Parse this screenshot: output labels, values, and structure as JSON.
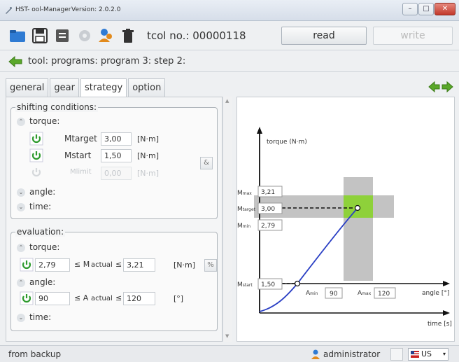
{
  "window": {
    "title": "HST- ool-Manager",
    "version": "Version: 2.0.2.0",
    "minimize": "–",
    "maximize": "□",
    "close": "✕"
  },
  "toolbar": {
    "tool_no": "tcol no.: 00000118",
    "read_label": "read",
    "write_label": "write",
    "icons": [
      "folder-icon",
      "save-icon",
      "list-icon",
      "gear-icon",
      "users-icon",
      "trash-icon"
    ]
  },
  "breadcrumb": "tool: programs: program 3: step 2:",
  "tabs": [
    "general",
    "gear",
    "strategy",
    "option"
  ],
  "active_tab": "strategy",
  "shifting": {
    "title": "shifting conditions:",
    "torque_label": "torque:",
    "rows": [
      {
        "label": "Mtarget",
        "value": "3,00",
        "unit": "[N·m]",
        "enabled": true
      },
      {
        "label": "Mstart",
        "value": "1,50",
        "unit": "[N·m]",
        "enabled": true
      },
      {
        "label": "Mlimit",
        "value": "0,00",
        "unit": "[N·m]",
        "enabled": false
      }
    ],
    "link_button": "&",
    "angle_label": "angle:",
    "time_label": "time:"
  },
  "evaluation": {
    "title": "evaluation:",
    "torque_label": "torque:",
    "torque_row": {
      "min": "2,79",
      "op1": "≤ M",
      "sub": "actual",
      "op2": "≤",
      "max": "3,21",
      "unit": "[N·m]"
    },
    "angle_label": "angle:",
    "angle_row": {
      "min": "90",
      "op1": "≤ A",
      "sub": "actual",
      "op2": "≤",
      "max": "120",
      "unit": "[°]"
    },
    "time_label": "time:",
    "percent_button": "%"
  },
  "chart": {
    "y_axis_label": "torque (N·m)",
    "x_axis_label": "angle [°]",
    "time_axis_label": "time [s]",
    "labels": {
      "mmax": {
        "name": "M",
        "sub": "max",
        "value": "3,21"
      },
      "mtarget": {
        "name": "M",
        "sub": "target",
        "value": "3,00"
      },
      "mmin": {
        "name": "M",
        "sub": "min",
        "value": "2,79"
      },
      "mstart": {
        "name": "M",
        "sub": "start",
        "value": "1,50"
      },
      "amin": {
        "name": "A",
        "sub": "min",
        "value": "90"
      },
      "amax": {
        "name": "A",
        "sub": "max",
        "value": "120"
      }
    },
    "colors": {
      "band": "#b8b8b8",
      "target": "#8ed13a",
      "curve": "#2a3fc4"
    }
  },
  "status": {
    "text": "from backup",
    "user": "administrator",
    "language": "US"
  }
}
